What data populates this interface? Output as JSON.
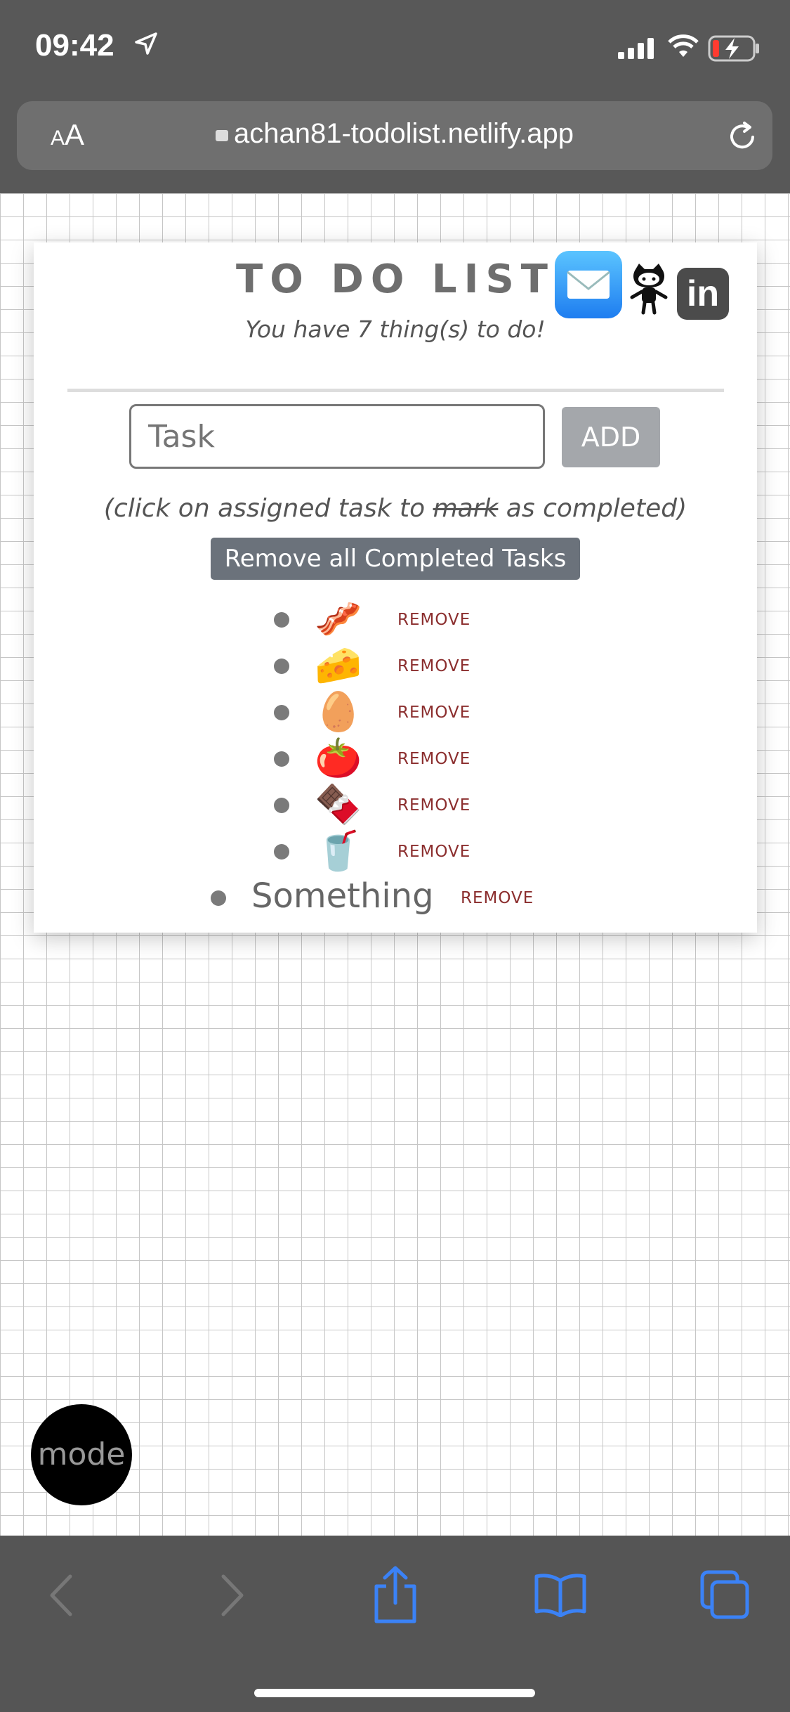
{
  "status": {
    "time": "09:42"
  },
  "browser": {
    "aa_small": "A",
    "aa_large": "A",
    "url": "achan81-todolist.netlify.app"
  },
  "card": {
    "title": "TO DO LIST",
    "subtitle": "You have 7 thing(s) to do!",
    "input_placeholder": "Task",
    "add_label": "ADD",
    "hint_before": "(click on assigned task to ",
    "hint_strike": "mark",
    "hint_after": " as completed)",
    "remove_completed_label": "Remove all Completed Tasks",
    "social": {
      "linkedin": "in"
    }
  },
  "tasks": [
    {
      "text": "🥓",
      "remove": "REMOVE"
    },
    {
      "text": "🧀",
      "remove": "REMOVE"
    },
    {
      "text": "🥚",
      "remove": "REMOVE"
    },
    {
      "text": "🍅",
      "remove": "REMOVE"
    },
    {
      "text": "🍫",
      "remove": "REMOVE"
    },
    {
      "text": "🥤",
      "remove": "REMOVE"
    },
    {
      "text": "Something",
      "remove": "REMOVE"
    }
  ],
  "mode_label": "mode",
  "colors": {
    "accent": "#3b82f6",
    "remove": "#8b2e2e",
    "button": "#6b727b"
  }
}
